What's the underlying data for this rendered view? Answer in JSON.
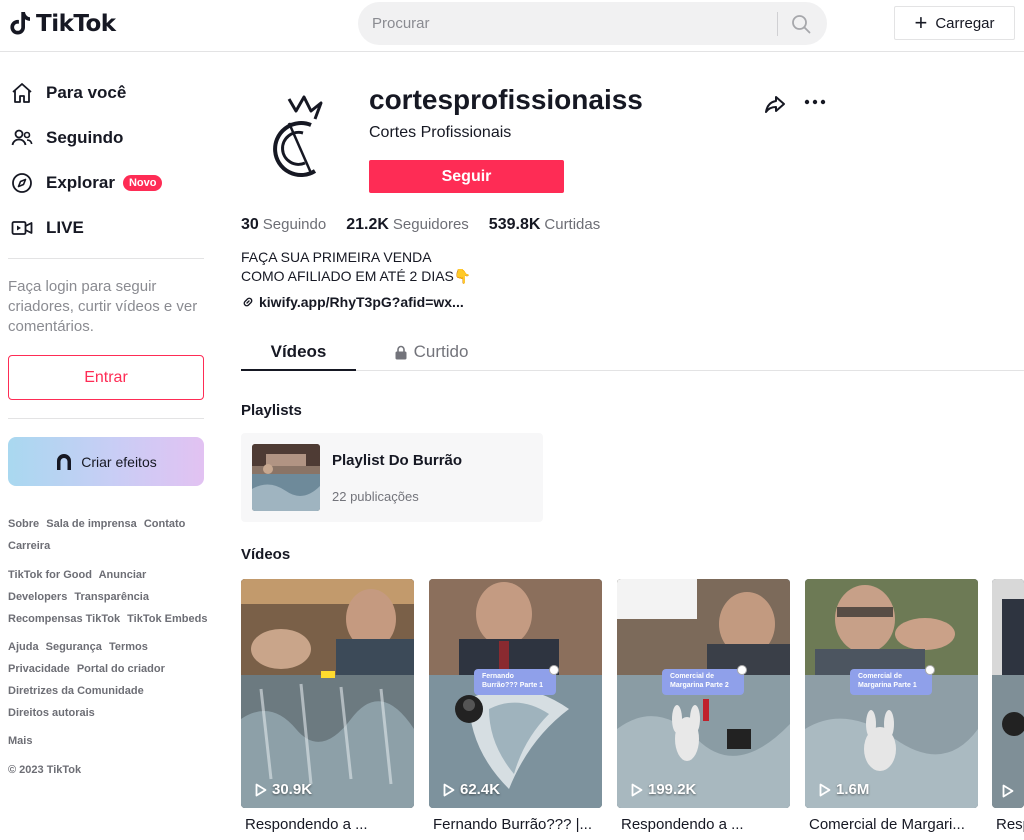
{
  "header": {
    "logo_text": "TikTok",
    "search_placeholder": "Procurar",
    "upload_label": "Carregar"
  },
  "sidebar": {
    "nav": [
      {
        "label": "Para você",
        "icon": "home-icon"
      },
      {
        "label": "Seguindo",
        "icon": "following-icon"
      },
      {
        "label": "Explorar",
        "icon": "compass-icon",
        "badge": "Novo"
      },
      {
        "label": "LIVE",
        "icon": "live-icon"
      }
    ],
    "login_prompt": "Faça login para seguir criadores, curtir vídeos e ver comentários.",
    "login_button": "Entrar",
    "effects_button": "Criar efeitos",
    "footer": {
      "group1": [
        "Sobre",
        "Sala de imprensa",
        "Contato",
        "Carreira"
      ],
      "group2": [
        "TikTok for Good",
        "Anunciar",
        "Developers",
        "Transparência",
        "Recompensas TikTok",
        "TikTok Embeds"
      ],
      "group3": [
        "Ajuda",
        "Segurança",
        "Termos",
        "Privacidade",
        "Portal do criador",
        "Diretrizes da Comunidade",
        "Direitos autorais"
      ],
      "more": "Mais",
      "copyright": "© 2023 TikTok"
    }
  },
  "profile": {
    "username": "cortesprofissionaiss",
    "nickname": "Cortes Profissionais",
    "follow_button": "Seguir",
    "stats": {
      "following_count": "30",
      "following_label": "Seguindo",
      "followers_count": "21.2K",
      "followers_label": "Seguidores",
      "likes_count": "539.8K",
      "likes_label": "Curtidas"
    },
    "bio_line1": "FAÇA SUA PRIMEIRA VENDA",
    "bio_line2": "COMO AFILIADO EM ATÉ 2 DIAS👇",
    "link": "kiwify.app/RhyT3pG?afid=wx..."
  },
  "tabs": {
    "videos": "Vídeos",
    "liked": "Curtido"
  },
  "playlists": {
    "title": "Playlists",
    "items": [
      {
        "name": "Playlist Do Burrão",
        "count": "22 publicações"
      }
    ]
  },
  "videos": {
    "title": "Vídeos",
    "items": [
      {
        "views": "30.9K",
        "caption": "Respondendo a ...",
        "sticker": ""
      },
      {
        "views": "62.4K",
        "caption": "Fernando Burrão??? |...",
        "sticker": "Fernando Burrão??? Parte 1"
      },
      {
        "views": "199.2K",
        "caption": "Respondendo a ...",
        "sticker": "Comercial de Margarina Parte 2"
      },
      {
        "views": "1.6M",
        "caption": "Comercial de Margari...",
        "sticker": "Comercial de Margarina Parte 1"
      },
      {
        "views": "",
        "caption": "Resp",
        "sticker": ""
      }
    ]
  },
  "colors": {
    "brand_red": "#fe2c55",
    "text_primary": "#161823",
    "text_secondary": "#73747b"
  }
}
